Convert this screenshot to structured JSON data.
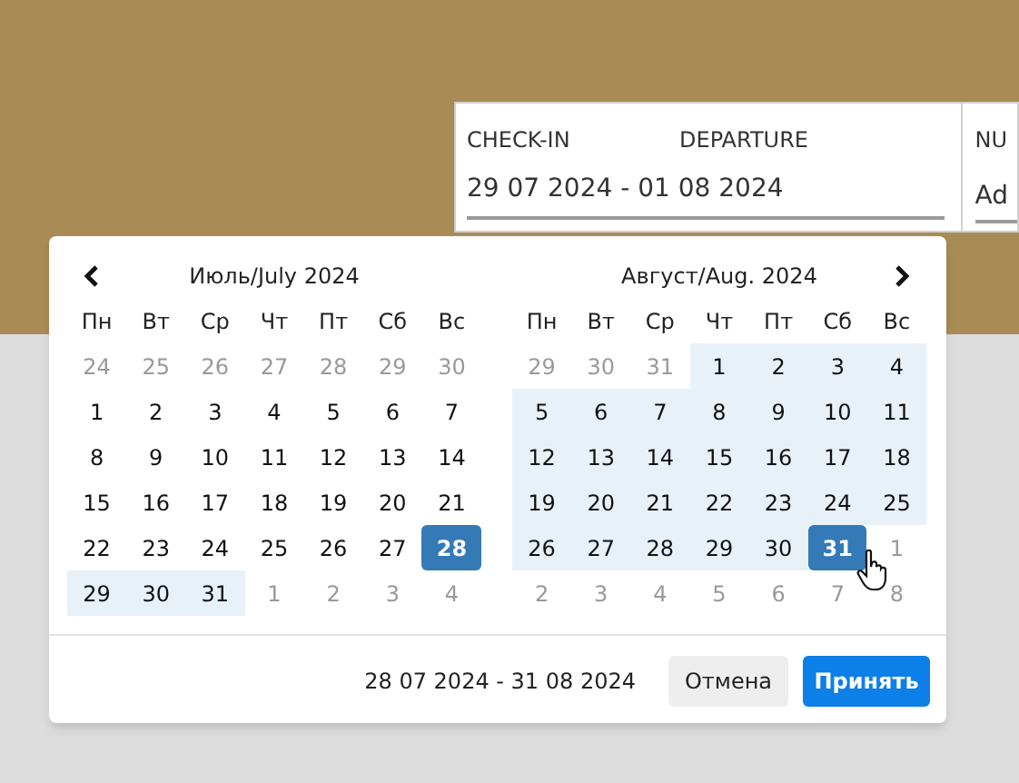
{
  "booking": {
    "checkin_label": "CHECK-IN",
    "departure_label": "DEPARTURE",
    "dates_value": "29 07 2024 - 01 08 2024",
    "next_label": "NU",
    "next_value": "Ad"
  },
  "calendar": {
    "months": [
      {
        "title": "Июль/July 2024",
        "nav": {
          "kind": "prev"
        },
        "weekdays": [
          "Пн",
          "Вт",
          "Ср",
          "Чт",
          "Пт",
          "Сб",
          "Вс"
        ],
        "days": [
          {
            "day": "24",
            "muted": true,
            "in_range": false,
            "selected": false
          },
          {
            "day": "25",
            "muted": true,
            "in_range": false,
            "selected": false
          },
          {
            "day": "26",
            "muted": true,
            "in_range": false,
            "selected": false
          },
          {
            "day": "27",
            "muted": true,
            "in_range": false,
            "selected": false
          },
          {
            "day": "28",
            "muted": true,
            "in_range": false,
            "selected": false
          },
          {
            "day": "29",
            "muted": true,
            "in_range": false,
            "selected": false
          },
          {
            "day": "30",
            "muted": true,
            "in_range": false,
            "selected": false
          },
          {
            "day": "1",
            "muted": false,
            "in_range": false,
            "selected": false
          },
          {
            "day": "2",
            "muted": false,
            "in_range": false,
            "selected": false
          },
          {
            "day": "3",
            "muted": false,
            "in_range": false,
            "selected": false
          },
          {
            "day": "4",
            "muted": false,
            "in_range": false,
            "selected": false
          },
          {
            "day": "5",
            "muted": false,
            "in_range": false,
            "selected": false
          },
          {
            "day": "6",
            "muted": false,
            "in_range": false,
            "selected": false
          },
          {
            "day": "7",
            "muted": false,
            "in_range": false,
            "selected": false
          },
          {
            "day": "8",
            "muted": false,
            "in_range": false,
            "selected": false
          },
          {
            "day": "9",
            "muted": false,
            "in_range": false,
            "selected": false
          },
          {
            "day": "10",
            "muted": false,
            "in_range": false,
            "selected": false
          },
          {
            "day": "11",
            "muted": false,
            "in_range": false,
            "selected": false
          },
          {
            "day": "12",
            "muted": false,
            "in_range": false,
            "selected": false
          },
          {
            "day": "13",
            "muted": false,
            "in_range": false,
            "selected": false
          },
          {
            "day": "14",
            "muted": false,
            "in_range": false,
            "selected": false
          },
          {
            "day": "15",
            "muted": false,
            "in_range": false,
            "selected": false
          },
          {
            "day": "16",
            "muted": false,
            "in_range": false,
            "selected": false
          },
          {
            "day": "17",
            "muted": false,
            "in_range": false,
            "selected": false
          },
          {
            "day": "18",
            "muted": false,
            "in_range": false,
            "selected": false
          },
          {
            "day": "19",
            "muted": false,
            "in_range": false,
            "selected": false
          },
          {
            "day": "20",
            "muted": false,
            "in_range": false,
            "selected": false
          },
          {
            "day": "21",
            "muted": false,
            "in_range": false,
            "selected": false
          },
          {
            "day": "22",
            "muted": false,
            "in_range": false,
            "selected": false
          },
          {
            "day": "23",
            "muted": false,
            "in_range": false,
            "selected": false
          },
          {
            "day": "24",
            "muted": false,
            "in_range": false,
            "selected": false
          },
          {
            "day": "25",
            "muted": false,
            "in_range": false,
            "selected": false
          },
          {
            "day": "26",
            "muted": false,
            "in_range": false,
            "selected": false
          },
          {
            "day": "27",
            "muted": false,
            "in_range": false,
            "selected": false
          },
          {
            "day": "28",
            "muted": false,
            "in_range": false,
            "selected": true
          },
          {
            "day": "29",
            "muted": false,
            "in_range": true,
            "selected": false
          },
          {
            "day": "30",
            "muted": false,
            "in_range": true,
            "selected": false
          },
          {
            "day": "31",
            "muted": false,
            "in_range": true,
            "selected": false
          },
          {
            "day": "1",
            "muted": true,
            "in_range": false,
            "selected": false
          },
          {
            "day": "2",
            "muted": true,
            "in_range": false,
            "selected": false
          },
          {
            "day": "3",
            "muted": true,
            "in_range": false,
            "selected": false
          },
          {
            "day": "4",
            "muted": true,
            "in_range": false,
            "selected": false
          }
        ]
      },
      {
        "title": "Август/Aug. 2024",
        "nav": {
          "kind": "next"
        },
        "weekdays": [
          "Пн",
          "Вт",
          "Ср",
          "Чт",
          "Пт",
          "Сб",
          "Вс"
        ],
        "days": [
          {
            "day": "29",
            "muted": true,
            "in_range": false,
            "selected": false
          },
          {
            "day": "30",
            "muted": true,
            "in_range": false,
            "selected": false
          },
          {
            "day": "31",
            "muted": true,
            "in_range": false,
            "selected": false
          },
          {
            "day": "1",
            "muted": false,
            "in_range": true,
            "selected": false
          },
          {
            "day": "2",
            "muted": false,
            "in_range": true,
            "selected": false
          },
          {
            "day": "3",
            "muted": false,
            "in_range": true,
            "selected": false
          },
          {
            "day": "4",
            "muted": false,
            "in_range": true,
            "selected": false
          },
          {
            "day": "5",
            "muted": false,
            "in_range": true,
            "selected": false
          },
          {
            "day": "6",
            "muted": false,
            "in_range": true,
            "selected": false
          },
          {
            "day": "7",
            "muted": false,
            "in_range": true,
            "selected": false
          },
          {
            "day": "8",
            "muted": false,
            "in_range": true,
            "selected": false
          },
          {
            "day": "9",
            "muted": false,
            "in_range": true,
            "selected": false
          },
          {
            "day": "10",
            "muted": false,
            "in_range": true,
            "selected": false
          },
          {
            "day": "11",
            "muted": false,
            "in_range": true,
            "selected": false
          },
          {
            "day": "12",
            "muted": false,
            "in_range": true,
            "selected": false
          },
          {
            "day": "13",
            "muted": false,
            "in_range": true,
            "selected": false
          },
          {
            "day": "14",
            "muted": false,
            "in_range": true,
            "selected": false
          },
          {
            "day": "15",
            "muted": false,
            "in_range": true,
            "selected": false
          },
          {
            "day": "16",
            "muted": false,
            "in_range": true,
            "selected": false
          },
          {
            "day": "17",
            "muted": false,
            "in_range": true,
            "selected": false
          },
          {
            "day": "18",
            "muted": false,
            "in_range": true,
            "selected": false
          },
          {
            "day": "19",
            "muted": false,
            "in_range": true,
            "selected": false
          },
          {
            "day": "20",
            "muted": false,
            "in_range": true,
            "selected": false
          },
          {
            "day": "21",
            "muted": false,
            "in_range": true,
            "selected": false
          },
          {
            "day": "22",
            "muted": false,
            "in_range": true,
            "selected": false
          },
          {
            "day": "23",
            "muted": false,
            "in_range": true,
            "selected": false
          },
          {
            "day": "24",
            "muted": false,
            "in_range": true,
            "selected": false
          },
          {
            "day": "25",
            "muted": false,
            "in_range": true,
            "selected": false
          },
          {
            "day": "26",
            "muted": false,
            "in_range": true,
            "selected": false
          },
          {
            "day": "27",
            "muted": false,
            "in_range": true,
            "selected": false
          },
          {
            "day": "28",
            "muted": false,
            "in_range": true,
            "selected": false
          },
          {
            "day": "29",
            "muted": false,
            "in_range": true,
            "selected": false
          },
          {
            "day": "30",
            "muted": false,
            "in_range": true,
            "selected": false
          },
          {
            "day": "31",
            "muted": false,
            "in_range": false,
            "selected": true
          },
          {
            "day": "1",
            "muted": true,
            "in_range": false,
            "selected": false
          },
          {
            "day": "2",
            "muted": true,
            "in_range": false,
            "selected": false
          },
          {
            "day": "3",
            "muted": true,
            "in_range": false,
            "selected": false
          },
          {
            "day": "4",
            "muted": true,
            "in_range": false,
            "selected": false
          },
          {
            "day": "5",
            "muted": true,
            "in_range": false,
            "selected": false
          },
          {
            "day": "6",
            "muted": true,
            "in_range": false,
            "selected": false
          },
          {
            "day": "7",
            "muted": true,
            "in_range": false,
            "selected": false
          },
          {
            "day": "8",
            "muted": true,
            "in_range": false,
            "selected": false
          }
        ]
      }
    ],
    "range_text": "28 07 2024 - 31 08 2024",
    "buttons": [
      {
        "label": "Отмена",
        "kind": "cancel"
      },
      {
        "label": "Принять",
        "kind": "apply"
      }
    ]
  }
}
